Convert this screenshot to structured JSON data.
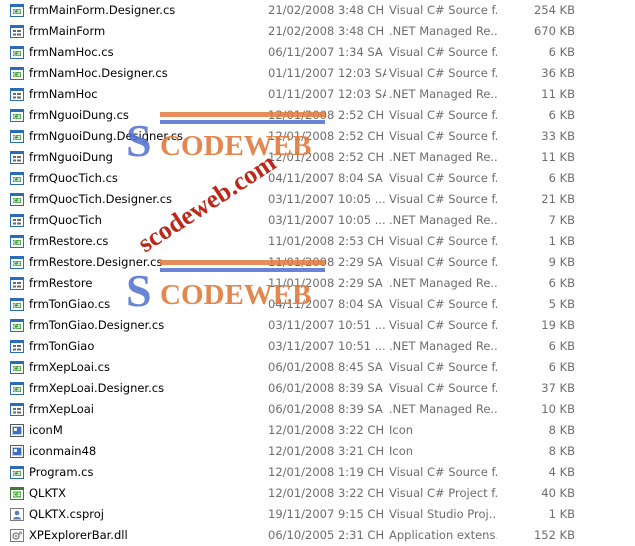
{
  "files": [
    {
      "name": "frmMainForm.Designer.cs",
      "date": "21/02/2008 3:48 CH",
      "type": "Visual C# Source f...",
      "size": "254 KB",
      "icon": "cs-file-icon"
    },
    {
      "name": "frmMainForm",
      "date": "21/02/2008 3:48 CH",
      "type": ".NET Managed Re...",
      "size": "670 KB",
      "icon": "resx-file-icon"
    },
    {
      "name": "frmNamHoc.cs",
      "date": "06/11/2007 1:34 SA",
      "type": "Visual C# Source f...",
      "size": "6 KB",
      "icon": "cs-file-icon"
    },
    {
      "name": "frmNamHoc.Designer.cs",
      "date": "01/11/2007 12:03 SA",
      "type": "Visual C# Source f...",
      "size": "36 KB",
      "icon": "cs-file-icon"
    },
    {
      "name": "frmNamHoc",
      "date": "01/11/2007 12:03 SA",
      "type": ".NET Managed Re...",
      "size": "11 KB",
      "icon": "resx-file-icon"
    },
    {
      "name": "frmNguoiDung.cs",
      "date": "12/01/2008 2:52 CH",
      "type": "Visual C# Source f...",
      "size": "6 KB",
      "icon": "cs-file-icon"
    },
    {
      "name": "frmNguoiDung.Designer.cs",
      "date": "12/01/2008 2:52 CH",
      "type": "Visual C# Source f...",
      "size": "33 KB",
      "icon": "cs-file-icon"
    },
    {
      "name": "frmNguoiDung",
      "date": "12/01/2008 2:52 CH",
      "type": ".NET Managed Re...",
      "size": "11 KB",
      "icon": "resx-file-icon"
    },
    {
      "name": "frmQuocTich.cs",
      "date": "04/11/2007 8:04 SA",
      "type": "Visual C# Source f...",
      "size": "6 KB",
      "icon": "cs-file-icon"
    },
    {
      "name": "frmQuocTich.Designer.cs",
      "date": "03/11/2007 10:05 ...",
      "type": "Visual C# Source f...",
      "size": "21 KB",
      "icon": "cs-file-icon"
    },
    {
      "name": "frmQuocTich",
      "date": "03/11/2007 10:05 ...",
      "type": ".NET Managed Re...",
      "size": "7 KB",
      "icon": "resx-file-icon"
    },
    {
      "name": "frmRestore.cs",
      "date": "11/01/2008 2:53 CH",
      "type": "Visual C# Source f...",
      "size": "1 KB",
      "icon": "cs-file-icon"
    },
    {
      "name": "frmRestore.Designer.cs",
      "date": "11/01/2008 2:29 SA",
      "type": "Visual C# Source f...",
      "size": "9 KB",
      "icon": "cs-file-icon"
    },
    {
      "name": "frmRestore",
      "date": "11/01/2008 2:29 SA",
      "type": ".NET Managed Re...",
      "size": "6 KB",
      "icon": "resx-file-icon"
    },
    {
      "name": "frmTonGiao.cs",
      "date": "04/11/2007 8:04 SA",
      "type": "Visual C# Source f...",
      "size": "5 KB",
      "icon": "cs-file-icon"
    },
    {
      "name": "frmTonGiao.Designer.cs",
      "date": "03/11/2007 10:51 ...",
      "type": "Visual C# Source f...",
      "size": "19 KB",
      "icon": "cs-file-icon"
    },
    {
      "name": "frmTonGiao",
      "date": "03/11/2007 10:51 ...",
      "type": ".NET Managed Re...",
      "size": "6 KB",
      "icon": "resx-file-icon"
    },
    {
      "name": "frmXepLoai.cs",
      "date": "06/01/2008 8:45 SA",
      "type": "Visual C# Source f...",
      "size": "6 KB",
      "icon": "cs-file-icon"
    },
    {
      "name": "frmXepLoai.Designer.cs",
      "date": "06/01/2008 8:39 SA",
      "type": "Visual C# Source f...",
      "size": "37 KB",
      "icon": "cs-file-icon"
    },
    {
      "name": "frmXepLoai",
      "date": "06/01/2008 8:39 SA",
      "type": ".NET Managed Re...",
      "size": "10 KB",
      "icon": "resx-file-icon"
    },
    {
      "name": "iconM",
      "date": "12/01/2008 3:22 CH",
      "type": "Icon",
      "size": "8 KB",
      "icon": "ico-file-icon"
    },
    {
      "name": "iconmain48",
      "date": "12/01/2008 3:21 CH",
      "type": "Icon",
      "size": "8 KB",
      "icon": "ico-file-icon"
    },
    {
      "name": "Program.cs",
      "date": "12/01/2008 1:19 CH",
      "type": "Visual C# Source f...",
      "size": "4 KB",
      "icon": "cs-file-icon"
    },
    {
      "name": "QLKTX",
      "date": "12/01/2008 3:22 CH",
      "type": "Visual C# Project f...",
      "size": "40 KB",
      "icon": "csproj-file-icon"
    },
    {
      "name": "QLKTX.csproj",
      "date": "19/11/2007 9:15 CH",
      "type": "Visual Studio Proj...",
      "size": "1 KB",
      "icon": "user-file-icon"
    },
    {
      "name": "XPExplorerBar.dll",
      "date": "06/10/2005 2:31 CH",
      "type": "Application extens...",
      "size": "152 KB",
      "icon": "dll-file-icon"
    }
  ],
  "watermark": {
    "brand": "CODEWEB",
    "brand_initial": "S",
    "url": "scodeweb.com",
    "colors": {
      "blue": "#4f6fd0",
      "orange": "#e07a3c",
      "red": "#b81c0c"
    }
  }
}
